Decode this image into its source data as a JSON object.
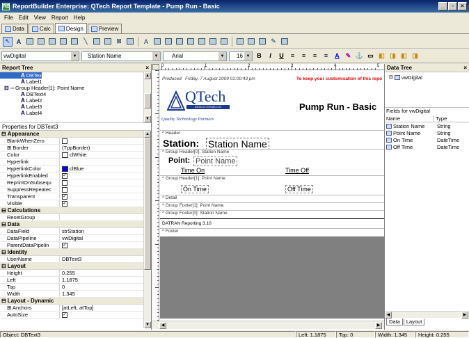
{
  "window": {
    "title": "ReportBuilder Enterprise: QTech Report Template - Pump Run - Basic",
    "app_icon": "RB",
    "min": "_",
    "max": "▫",
    "close": "×"
  },
  "menu": [
    "File",
    "Edit",
    "View",
    "Report",
    "Help"
  ],
  "tabs": [
    {
      "label": "Data",
      "active": false
    },
    {
      "label": "Calc",
      "active": false
    },
    {
      "label": "Design",
      "active": true
    },
    {
      "label": "Preview",
      "active": false
    }
  ],
  "format_bar": {
    "pipeline": "vwDigital",
    "field": "Station Name",
    "font": "Arial",
    "size": "16",
    "bold": "B",
    "italic": "I",
    "underline": "U"
  },
  "report_tree": {
    "title": "Report Tree",
    "close": "×",
    "items": [
      {
        "label": "DBText3",
        "indent": 2,
        "icon": "A",
        "selected": true
      },
      {
        "label": "Label1",
        "indent": 2,
        "icon": "A"
      },
      {
        "label": "Group Header[1]: Point Name",
        "indent": 1,
        "icon": "⊟"
      },
      {
        "label": "DBText4",
        "indent": 2,
        "icon": "A"
      },
      {
        "label": "Label2",
        "indent": 2,
        "icon": "A"
      },
      {
        "label": "Label3",
        "indent": 2,
        "icon": "A"
      },
      {
        "label": "Label4",
        "indent": 2,
        "icon": "A"
      }
    ]
  },
  "properties": {
    "title": "Properties for DBText3",
    "groups": [
      {
        "name": "Appearance",
        "props": [
          {
            "n": "BlankWhenZero",
            "v": "",
            "chk": false
          },
          {
            "n": "⊞ Border",
            "v": "(TppBorder)"
          },
          {
            "n": "Color",
            "v": "clWhite",
            "swatch": "#ffffff"
          },
          {
            "n": "Hyperlink",
            "v": ""
          },
          {
            "n": "HyperlinkColor",
            "v": "clBlue",
            "swatch": "#0000ff"
          },
          {
            "n": "HyperlinkEnabled",
            "v": "",
            "chk": true
          },
          {
            "n": "ReprintOnSubsequ",
            "v": "",
            "chk": false
          },
          {
            "n": "SuppressRepeatec",
            "v": "",
            "chk": false
          },
          {
            "n": "Transparent",
            "v": "",
            "chk": true
          },
          {
            "n": "Visible",
            "v": "",
            "chk": true
          }
        ]
      },
      {
        "name": "Calculations",
        "props": [
          {
            "n": "ResetGroup",
            "v": ""
          }
        ]
      },
      {
        "name": "Data",
        "props": [
          {
            "n": "DataField",
            "v": "strStation"
          },
          {
            "n": "DataPipeline",
            "v": "vwDigital"
          },
          {
            "n": "ParentDataPipelin",
            "v": "",
            "chk": true
          }
        ]
      },
      {
        "name": "Identity",
        "props": [
          {
            "n": "UserName",
            "v": "DBText3"
          }
        ]
      },
      {
        "name": "Layout",
        "props": [
          {
            "n": "Height",
            "v": "0.255"
          },
          {
            "n": "Left",
            "v": "1.1875"
          },
          {
            "n": "Top",
            "v": "0"
          },
          {
            "n": "Width",
            "v": "1.345"
          }
        ]
      },
      {
        "name": "Layout - Dynamic",
        "props": [
          {
            "n": "⊞ Anchors",
            "v": "[atLeft, atTop]"
          },
          {
            "n": "AutoSize",
            "v": "",
            "chk": true
          }
        ]
      }
    ]
  },
  "design": {
    "produced": "Produced",
    "date": "Friday, 7 August 2009 01:00:43 pm",
    "notice": "To keep your customisation of this repo",
    "logo_text": "QTech",
    "logo_sub": "DATA SYSTEMS LTD",
    "tagline": "Quality Technology Partners",
    "report_title": "Pump Run - Basic",
    "bands": {
      "header": "^ Header",
      "gh0": "^ Group Header[0]: Station Name",
      "gh1": "^ Group Header[1]: Point Name",
      "detail": "^ Detail",
      "gf1": "^ Group Footer[1]: Point Name",
      "gf0": "^ Group Footer[0]: Station Name",
      "footer": "^ Footer"
    },
    "station_label": "Station:",
    "station_field": "Station Name",
    "point_label": "Point:",
    "point_field": "Point Name",
    "time_on_label": "Time On",
    "time_off_label": "Time Off",
    "on_time_field": "On Time",
    "off_time_field": "Off Time",
    "footer_text": "DATRAN Reporting 3.10",
    "ruler_top": [
      "0",
      "1",
      "2",
      "3",
      "4",
      "5"
    ]
  },
  "data_tree": {
    "title": "Data Tree",
    "close": "×",
    "pipeline": "vwDigital",
    "fields_title": "Fields for vwDigital",
    "col_name": "Name",
    "col_type": "Type",
    "fields": [
      {
        "name": "Station Name",
        "type": "String"
      },
      {
        "name": "Point Name",
        "type": "String"
      },
      {
        "name": "On Time",
        "type": "DateTime"
      },
      {
        "name": "Off Time",
        "type": "DateTime"
      }
    ],
    "tab_data": "Data",
    "tab_layout": "Layout"
  },
  "status": {
    "object": "Object: DBText3",
    "left": "Left: 1.1875",
    "top": "Top: 0",
    "width": "Width: 1.345",
    "height": "Height: 0.255"
  }
}
